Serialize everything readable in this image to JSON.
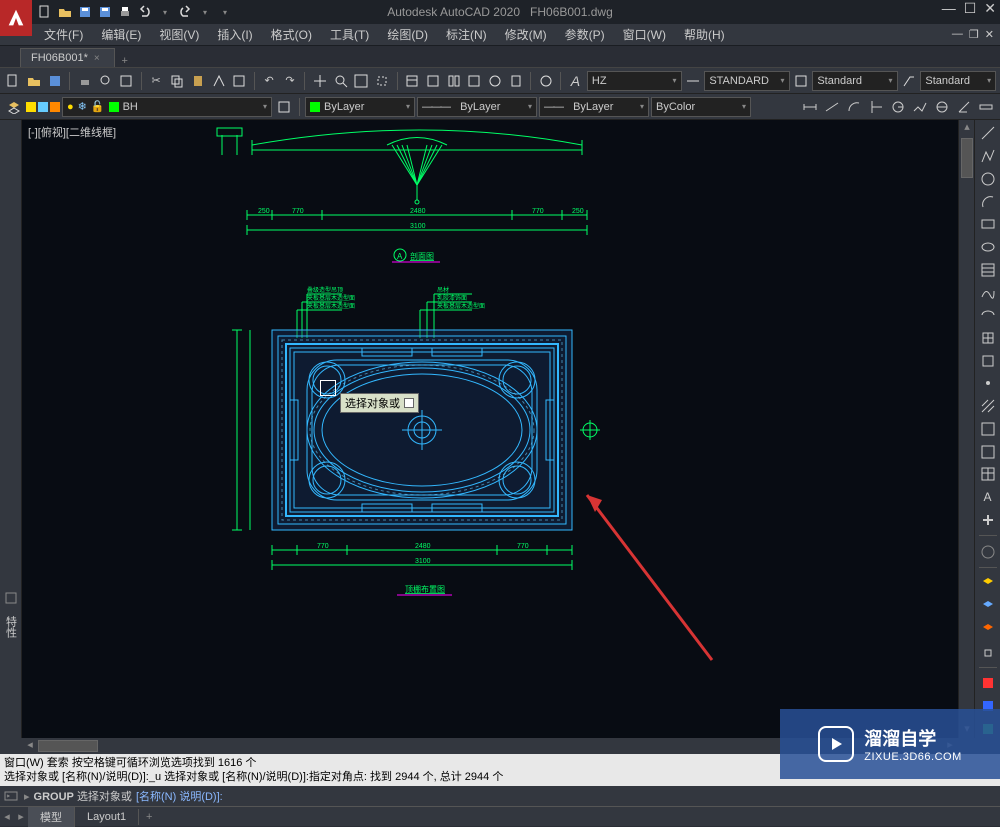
{
  "title": {
    "app": "Autodesk AutoCAD 2020",
    "file": "FH06B001.dwg"
  },
  "menus": [
    "文件(F)",
    "编辑(E)",
    "视图(V)",
    "插入(I)",
    "格式(O)",
    "工具(T)",
    "绘图(D)",
    "标注(N)",
    "修改(M)",
    "参数(P)",
    "窗口(W)",
    "帮助(H)"
  ],
  "filetab": {
    "name": "FH06B001*",
    "close": "×"
  },
  "toolbar_styles": {
    "textstyle": "HZ",
    "dimstyle": "STANDARD",
    "tablestyle": "Standard",
    "mleader": "Standard",
    "a_label": "A"
  },
  "layer": {
    "name": "BH",
    "linetype_label": "ByLayer",
    "lineweight_label": "ByLayer",
    "plotstyle": "ByColor"
  },
  "view_label": "[-][俯视][二维线框]",
  "left_dock_label": "特性",
  "cmd_history": [
    "窗口(W) 套索  按空格键可循环浏览选项找到 1616 个",
    "选择对象或 [名称(N)/说明(D)]:_u 选择对象或 [名称(N)/说明(D)]:指定对角点: 找到 2944 个, 总计 2944 个"
  ],
  "cmd_prompt": {
    "cmd": "GROUP",
    "text": "选择对象或",
    "hint": "[名称(N) 说明(D)]:"
  },
  "bottom_tabs": [
    "模型",
    "Layout1"
  ],
  "tooltip": "选择对象或",
  "watermark": {
    "brand": "溜溜自学",
    "url": "ZIXUE.3D66.COM"
  },
  "drawing_labels": {
    "section": "剖面图",
    "plan": "顶棚布置图"
  },
  "dimensions": {
    "d770": "770",
    "d2480": "2480",
    "d3100": "3100",
    "d250": "250"
  },
  "colors": {
    "green": "#00ff66",
    "cyan": "#33b8ff",
    "magenta": "#ff00ff",
    "select_blue": "#3a5fa8",
    "accent_red": "#d73434"
  }
}
